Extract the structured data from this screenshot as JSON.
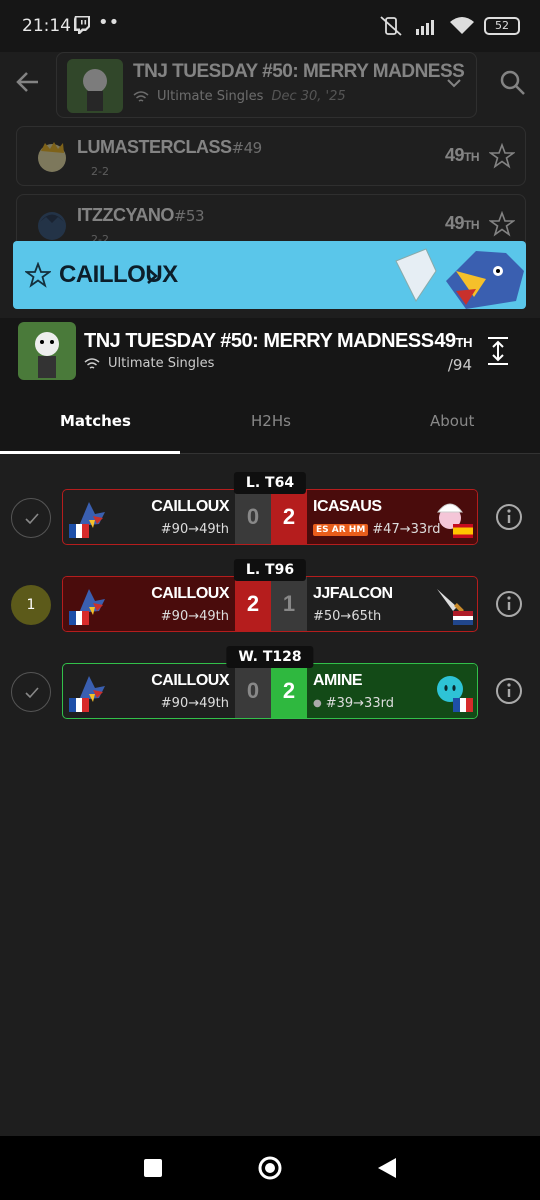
{
  "status_bar": {
    "time": "21:14",
    "dots": "••",
    "battery": "52"
  },
  "header": {
    "tournament_title": "TNJ TUESDAY #50: MERRY MADNESS",
    "event": "Ultimate Singles",
    "date": "Dec 30, '25"
  },
  "background_rows": [
    {
      "name": "LUMASTERCLASS",
      "seed": "#49",
      "record": "2-2",
      "place": "49",
      "suffix": "TH"
    },
    {
      "name": "ITZZCYANO",
      "seed": "#53",
      "record": "2-2",
      "place": "49",
      "suffix": "TH"
    }
  ],
  "banner": {
    "player_name": "CAILLOUX"
  },
  "info_panel": {
    "title": "TNJ TUESDAY #50: MERRY MADNESS",
    "event": "Ultimate Singles",
    "placement": "49",
    "placement_suffix": "TH",
    "total": "/94"
  },
  "tabs": [
    {
      "label": "Matches",
      "active": true
    },
    {
      "label": "H2Hs",
      "active": false
    },
    {
      "label": "About",
      "active": false
    }
  ],
  "matches": [
    {
      "round": "L. T64",
      "left_marker": "✓",
      "left": {
        "name": "CAILLOUX",
        "seed": "#90→49th",
        "score": "0"
      },
      "right": {
        "name": "ICASAUS",
        "tag": "ES AR HM",
        "seed": "#47→33rd",
        "score": "2"
      }
    },
    {
      "round": "L. T96",
      "left_marker": "1",
      "left": {
        "name": "CAILLOUX",
        "seed": "#90→49th",
        "score": "2"
      },
      "right": {
        "name": "JJFALCON",
        "seed": "#50→65th",
        "score": "1"
      }
    },
    {
      "round": "W. T128",
      "left_marker": "✓",
      "left": {
        "name": "CAILLOUX",
        "seed": "#90→49th",
        "score": "0"
      },
      "right": {
        "name": "AMINE",
        "seed_prefix": "●",
        "seed": "#39→33rd",
        "score": "2"
      }
    }
  ],
  "colors": {
    "banner_bg": "#5ac6ea",
    "loss_red": "#b51d1d",
    "win_green": "#32c04a",
    "win_bg": "#134a17",
    "loss_bg": "#4a0c0c",
    "tag_orange": "#e85d1b",
    "rank_badge": "#5c5a1a"
  },
  "icons": [
    "twitch-icon",
    "back-arrow-icon",
    "search-icon",
    "chevron-down-icon",
    "star-icon",
    "chevron-right-icon",
    "expand-vertical-icon",
    "check-icon",
    "info-icon",
    "wifi-icon",
    "falco-icon",
    "flag-france",
    "flag-spain",
    "flag-netherlands",
    "nav-square-icon",
    "nav-circle-icon",
    "nav-back-icon"
  ]
}
